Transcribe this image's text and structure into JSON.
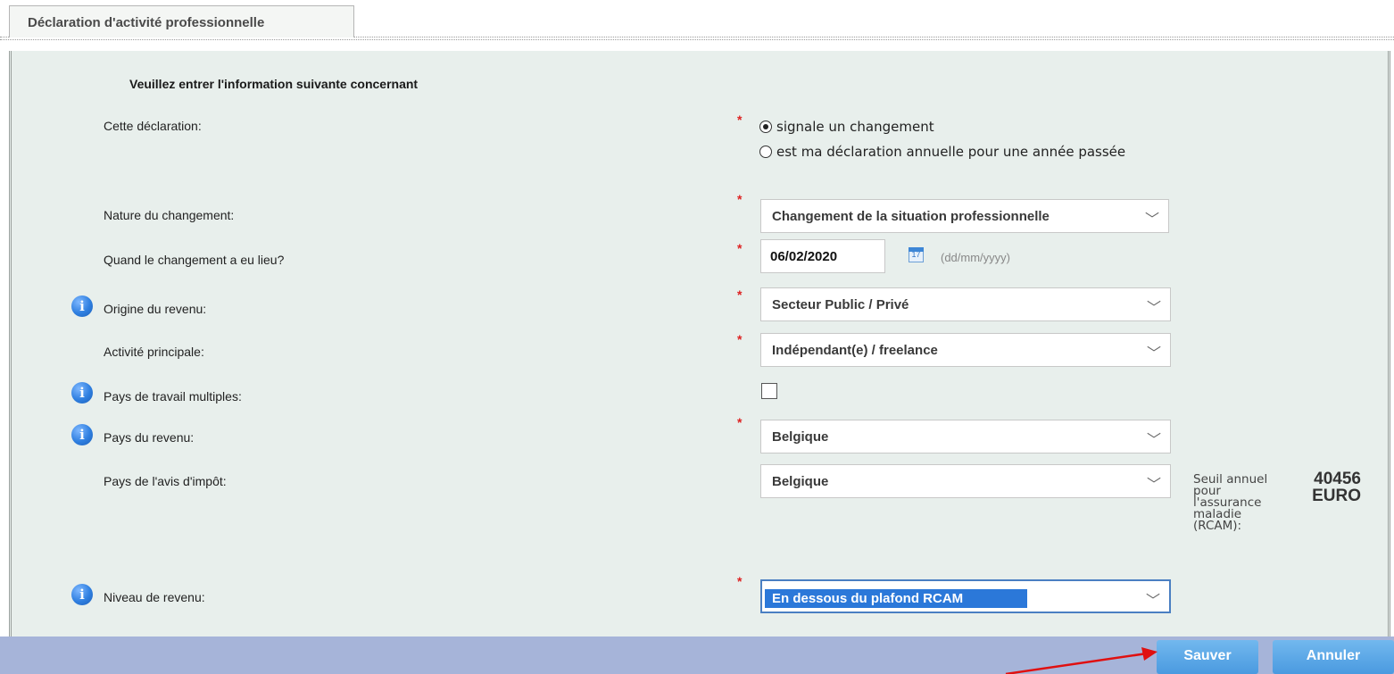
{
  "tab": {
    "label": "Déclaration d'activité professionnelle"
  },
  "form": {
    "intro": "Veuillez entrer l'information suivante concernant",
    "required_mark": "*",
    "declaration": {
      "label": "Cette déclaration:",
      "options": [
        {
          "label": "signale un changement",
          "selected": true
        },
        {
          "label": "est ma déclaration annuelle pour une année passée",
          "selected": false
        }
      ]
    },
    "nature": {
      "label": "Nature du changement:",
      "value": "Changement de la situation professionnelle"
    },
    "date": {
      "label": "Quand le changement a eu lieu?",
      "value": "06/02/2020",
      "hint": "(dd/mm/yyyy)"
    },
    "origine": {
      "label": "Origine du revenu:",
      "value": "Secteur Public / Privé"
    },
    "activite": {
      "label": "Activité principale:",
      "value": "Indépendant(e) / freelance"
    },
    "multiples": {
      "label": "Pays de travail multiples:",
      "checked": false
    },
    "pays_revenu": {
      "label": "Pays du revenu:",
      "value": "Belgique"
    },
    "pays_impot": {
      "label": "Pays de l'avis d'impôt:",
      "value": "Belgique"
    },
    "seuil": {
      "label": "Seuil annuel pour l'assurance maladie (RCAM):",
      "amount": "40456",
      "currency": "EURO"
    },
    "niveau": {
      "label": "Niveau de revenu:",
      "value": "En dessous du plafond RCAM"
    }
  },
  "buttons": {
    "save": "Sauver",
    "cancel": "Annuler"
  },
  "icons": {
    "info": "info-icon",
    "calendar": "calendar-icon",
    "chevron": "chevron-down-icon"
  },
  "colors": {
    "panel": "#e8efec",
    "footer": "#a6b4d9",
    "button": "#5aa6e6",
    "required": "#dd2222",
    "arrow": "#e01010"
  }
}
